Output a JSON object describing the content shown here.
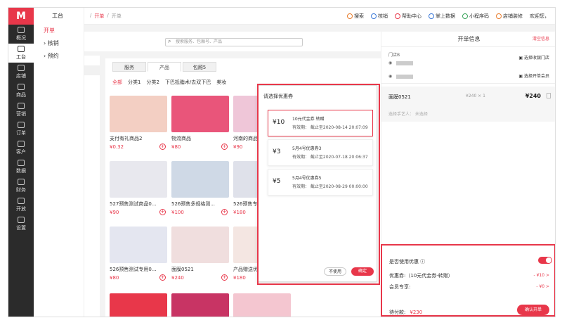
{
  "rail": [
    {
      "label": "概况"
    },
    {
      "label": "工台",
      "active": true
    },
    {
      "label": "店铺"
    },
    {
      "label": "商品"
    },
    {
      "label": "营销"
    },
    {
      "label": "订单"
    },
    {
      "label": "客户"
    },
    {
      "label": "数据"
    },
    {
      "label": "财务"
    },
    {
      "label": "开放"
    },
    {
      "label": "设置"
    }
  ],
  "sidebar": {
    "title": "工台",
    "items": [
      {
        "label": "开单"
      },
      {
        "label": "核销"
      },
      {
        "label": "预约"
      }
    ]
  },
  "topbar": {
    "crumb1": "开单",
    "crumb2": "开单",
    "links": [
      "搜索",
      "核销",
      "帮助中心",
      "掌上数据",
      "小程序码",
      "店铺装修",
      "欢迎您，"
    ]
  },
  "search": {
    "placeholder": "搜索服务、包厢号、产品"
  },
  "tabs": [
    "服务",
    "产品",
    "包厢5"
  ],
  "categories": [
    "全部",
    "分类1",
    "分类2",
    "下巴抵脂术/去双下巴",
    "美妆"
  ],
  "products": [
    {
      "name": "支付有礼商品2",
      "price": "¥0.32"
    },
    {
      "name": "物流商品",
      "price": "¥80"
    },
    {
      "name": "河南的商品",
      "price": "¥90"
    },
    {
      "name": "527预售测试商品0...",
      "price": "¥90"
    },
    {
      "name": "526预售多规格测...",
      "price": "¥100"
    },
    {
      "name": "526预售专用",
      "price": "¥180"
    },
    {
      "name": "526预售测试专用0...",
      "price": "¥80"
    },
    {
      "name": "面膜0521",
      "price": "¥240"
    },
    {
      "name": "产品赠送优惠",
      "price": "¥180"
    }
  ],
  "right": {
    "title": "开单信息",
    "clear": "清空信息",
    "store": "门店B",
    "pick_store": "选择收银门店",
    "pick_member": "选择开单会员",
    "item": {
      "name": "面膜0521",
      "qty": "¥240 × 1",
      "price": "¥240",
      "staff": "选择手艺人：  未选择"
    },
    "use_coupon": "是否使用优惠",
    "coupon_row": "优惠券:（10元代金券-转赠）",
    "coupon_val": "- ¥10 >",
    "member_row": "会员专享:",
    "member_val": "- ¥0 >",
    "pay_label": "待付款:",
    "pay_amount": "¥230",
    "confirm": "确认开单"
  },
  "popup": {
    "title": "请选择优惠券",
    "coupons": [
      {
        "value": "¥10",
        "title": "10元代金券  转赠",
        "date": "有效期：  截止至2020-08-14 20:07:09"
      },
      {
        "value": "¥3",
        "title": "5月4号优惠券3",
        "date": "有效期：  截止至2020-07-18 20:06:37"
      },
      {
        "value": "¥5",
        "title": "5月4号优惠券5",
        "date": "有效期：  截止至2020-08-29 00:00:00"
      }
    ],
    "nouse": "不使用",
    "ok": "确定"
  }
}
